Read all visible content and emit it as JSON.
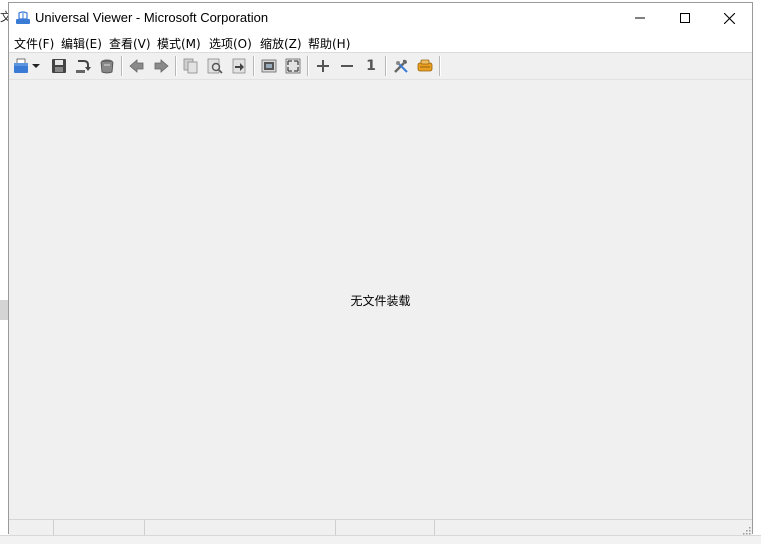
{
  "window": {
    "title": "Universal Viewer - Microsoft Corporation"
  },
  "menu": [
    {
      "label": "文件(F)"
    },
    {
      "label": "编辑(E)"
    },
    {
      "label": "查看(V)"
    },
    {
      "label": "模式(M)"
    },
    {
      "label": "选项(O)"
    },
    {
      "label": "缩放(Z)"
    },
    {
      "label": "帮助(H)"
    }
  ],
  "toolbar": {
    "icons": [
      "open-file-icon",
      "dropdown-arrow-icon",
      "save-icon",
      "reload-icon",
      "print-icon",
      "back-icon",
      "forward-icon",
      "copy-icon",
      "find-icon",
      "goto-icon",
      "fit-window-icon",
      "fullscreen-icon",
      "zoom-in-icon",
      "zoom-out-icon",
      "actual-size-icon",
      "tools-icon",
      "plugins-icon"
    ],
    "actual_size_label": "1"
  },
  "content": {
    "empty_message": "无文件装载"
  },
  "background": {
    "left_char": "文"
  },
  "colors": {
    "accent": "#3a7bd5",
    "window_bg": "#f0f0f0",
    "titlebar_bg": "#ffffff"
  }
}
